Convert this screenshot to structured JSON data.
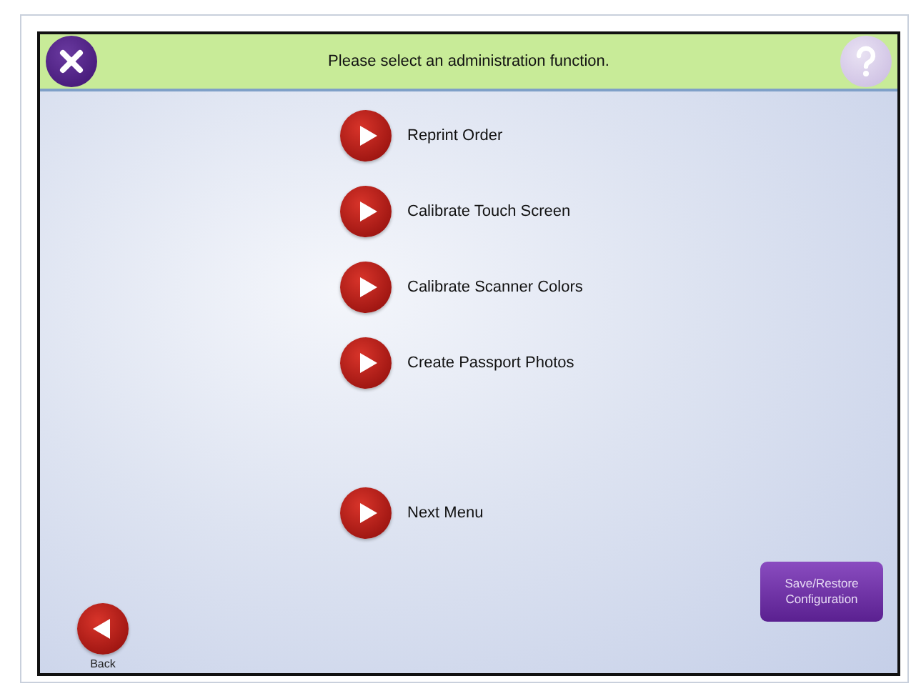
{
  "header": {
    "title": "Please select an administration function."
  },
  "menu_items": [
    {
      "label": "Reprint Order"
    },
    {
      "label": "Calibrate Touch Screen"
    },
    {
      "label": "Calibrate Scanner Colors"
    },
    {
      "label": "Create Passport Photos"
    }
  ],
  "next_menu": {
    "label": "Next Menu"
  },
  "back": {
    "label": "Back"
  },
  "config_button": {
    "label": "Save/Restore Configuration"
  }
}
